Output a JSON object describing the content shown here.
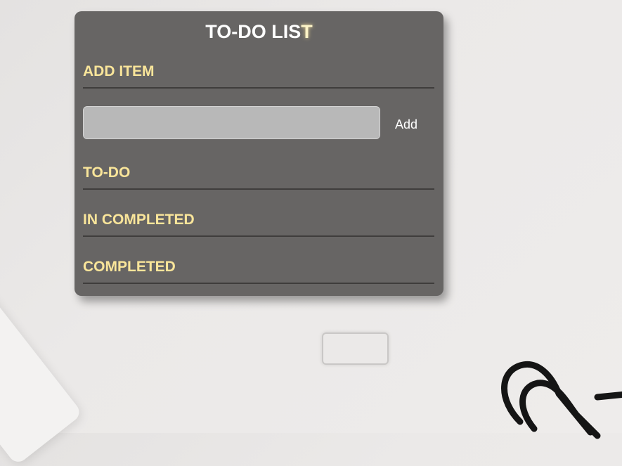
{
  "app": {
    "title_main": "TO-DO LIS",
    "title_last": "T"
  },
  "sections": {
    "add_item": "ADD ITEM",
    "todo": "TO-DO",
    "in_completed": "IN COMPLETED",
    "completed": "COMPLETED"
  },
  "add_form": {
    "input_value": "",
    "input_placeholder": "",
    "button_label": "Add"
  },
  "colors": {
    "card_bg": "#676564",
    "section_heading": "#f9e59a",
    "title": "#ffffff"
  }
}
